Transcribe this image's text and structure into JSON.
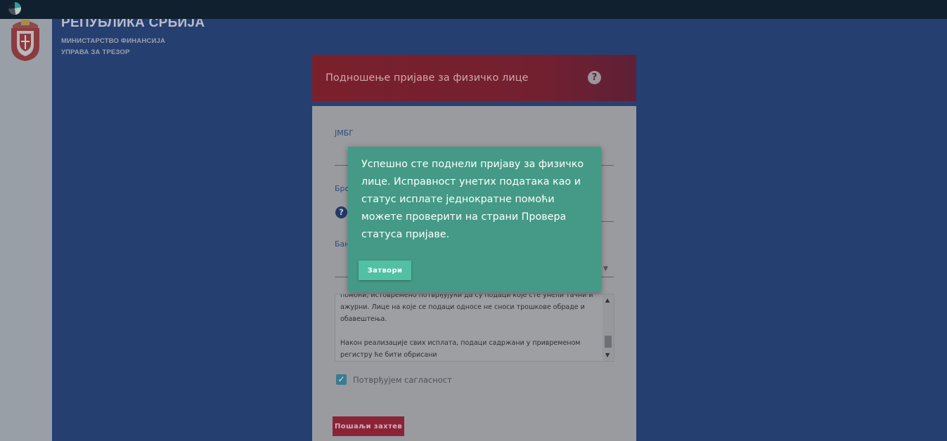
{
  "header": {
    "title": "РЕПУБЛИКА СРБИЈА",
    "ministry": "МИНИСТАРСТВО ФИНАНСИЈА",
    "office": "УПРАВА ЗА ТРЕЗОР"
  },
  "card": {
    "title": "Подношење пријаве за физичко лице",
    "help_glyph": "?"
  },
  "form": {
    "jmbg_label": "ЈМБГ",
    "id_label_visible": "Бро",
    "bank_label_visible": "Бан",
    "help_glyph": "?",
    "terms_lines": [
      "помоћи, истовремено потврђујући да су подаци које сте унели тачни и",
      "ажурни. Лице на које се подаци односе не сноси трошкове обраде и",
      "обавештења.",
      "",
      "Након реализације свих исплата, подаци садржани у привременом",
      "регистру ће бити обрисани"
    ],
    "consent_label": "Потврђујем сагласност",
    "consent_checked": true,
    "submit_label": "Пошаљи захтев"
  },
  "modal": {
    "message": "Успешно сте поднели пријаву за физичко лице. Исправност унетих података као и статус исплате једнократне помоћи можете проверити на страни Провера статуса пријаве.",
    "close_label": "Затвори"
  },
  "colors": {
    "page_bg": "#263f71",
    "topbar": "#11202e",
    "card_header": "#7a202c",
    "modal_bg": "#449a86",
    "close_button": "#51c0a5",
    "submit_button": "#8b2336"
  }
}
